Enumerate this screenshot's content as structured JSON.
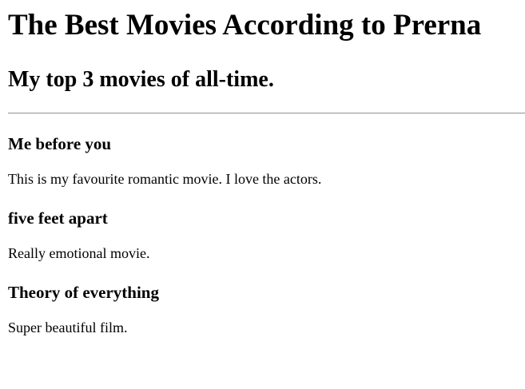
{
  "header": {
    "title": "The Best Movies According to Prerna",
    "subtitle": "My top 3 movies of all-time."
  },
  "movies": [
    {
      "title": "Me before you",
      "description": "This is my favourite romantic movie. I love the actors."
    },
    {
      "title": "five feet apart",
      "description": "Really emotional movie."
    },
    {
      "title": "Theory of everything",
      "description": "Super beautiful film."
    }
  ]
}
